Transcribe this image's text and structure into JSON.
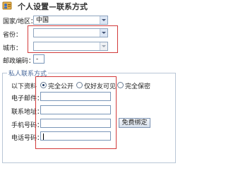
{
  "header": {
    "title": "个人设置—联系方式",
    "icon": "user-card-icon"
  },
  "location": {
    "country_label": "国家/地区：",
    "country_value": "中国",
    "province_label": "省份：",
    "province_value": "",
    "city_label": "城市：",
    "city_value": ""
  },
  "postal": {
    "label": "邮政编码：",
    "value": "-"
  },
  "private_contact": {
    "legend": "私人联系方式",
    "privacy_label": "以下资料",
    "privacy_options": [
      "完全公开",
      "仅好友可见",
      "完全保密"
    ],
    "privacy_selected": "完全公开",
    "email_label": "电子邮件：",
    "address_label": "联系地址：",
    "mobile_label": "手机号码：",
    "mobile_button": "免费绑定",
    "phone_label": "电话号码："
  },
  "highlight_color": "#d23a3a",
  "border_color": "#8fa5bf"
}
